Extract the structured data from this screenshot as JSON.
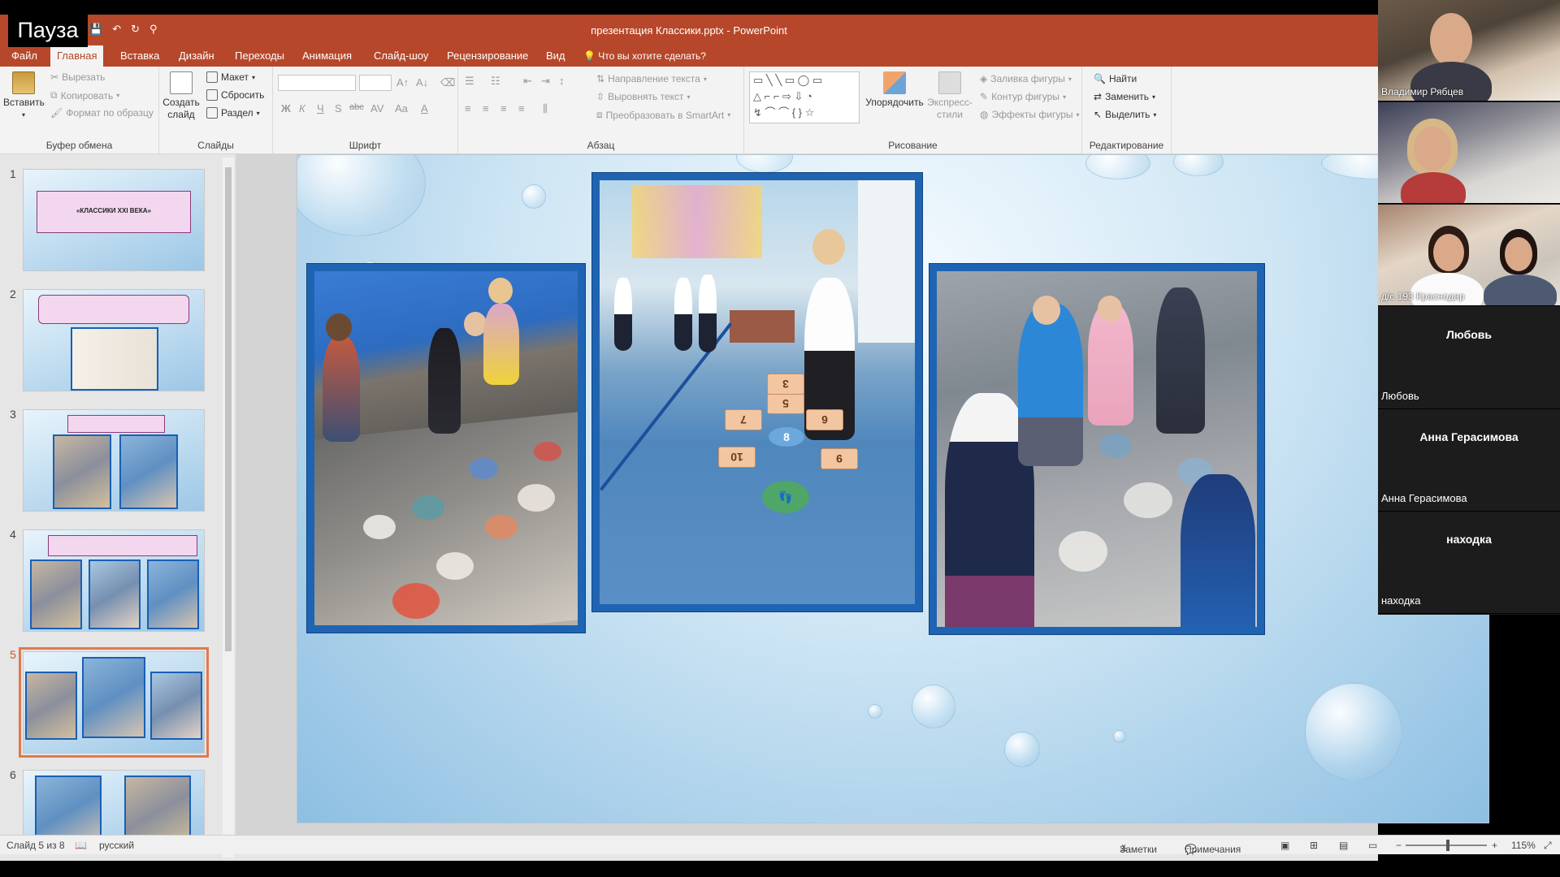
{
  "window": {
    "title": "презентация Классики.pptx - PowerPoint"
  },
  "pause_label": "Пауза",
  "tabs": [
    {
      "label": "Файл"
    },
    {
      "label": "Главная"
    },
    {
      "label": "Вставка"
    },
    {
      "label": "Дизайн"
    },
    {
      "label": "Переходы"
    },
    {
      "label": "Анимация"
    },
    {
      "label": "Слайд-шоу"
    },
    {
      "label": "Рецензирование"
    },
    {
      "label": "Вид"
    }
  ],
  "tellme": "Что вы хотите сделать?",
  "ribbon": {
    "clipboard": {
      "name": "Буфер обмена",
      "paste": "Вставить",
      "cut": "Вырезать",
      "copy": "Копировать",
      "format_painter": "Формат по образцу"
    },
    "slides": {
      "name": "Слайды",
      "new_slide": "Создать слайд",
      "layout": "Макет",
      "reset": "Сбросить",
      "section": "Раздел"
    },
    "font": {
      "name": "Шрифт",
      "bold": "Ж",
      "italic": "К",
      "underline": "Ч",
      "shadow": "S",
      "strike": "abc",
      "spacing": "AV",
      "case": "Aa",
      "color": "A"
    },
    "paragraph": {
      "name": "Абзац",
      "direction": "Направление текста",
      "align": "Выровнять текст",
      "smartart": "Преобразовать в SmartArt"
    },
    "drawing": {
      "name": "Рисование",
      "arrange": "Упорядочить",
      "quick_styles": "Экспресс-стили",
      "fill": "Заливка фигуры",
      "outline": "Контур фигуры",
      "effects": "Эффекты фигуры"
    },
    "editing": {
      "name": "Редактирование",
      "find": "Найти",
      "replace": "Заменить",
      "select": "Выделить"
    }
  },
  "thumbnails": [
    {
      "num": "1",
      "title": "«КЛАССИКИ XXI ВЕКА»"
    },
    {
      "num": "2"
    },
    {
      "num": "3"
    },
    {
      "num": "4"
    },
    {
      "num": "5"
    },
    {
      "num": "6"
    }
  ],
  "slide": {
    "hopscotch_numbers": [
      "10",
      "8",
      "9",
      "7",
      "6",
      "5",
      "3"
    ]
  },
  "status": {
    "slide_of": "Слайд 5 из 8",
    "language": "русский",
    "notes": "Заметки",
    "comments": "Примечания",
    "zoom": "115%"
  },
  "participants": [
    {
      "name": "Владимир Рябцев",
      "video": true
    },
    {
      "name": "",
      "video": true
    },
    {
      "name": "д/с 193 Краснодар",
      "video": true
    },
    {
      "name": "Любовь",
      "display": "Любовь",
      "video": false
    },
    {
      "name": "Анна Герасимова",
      "display": "Анна Герасимова",
      "video": false
    },
    {
      "name": "находка",
      "display": "находка",
      "video": false
    }
  ],
  "colors": {
    "ppt_accent": "#b7472a",
    "frame_blue": "#1e64b3",
    "selection": "#e1784f"
  }
}
